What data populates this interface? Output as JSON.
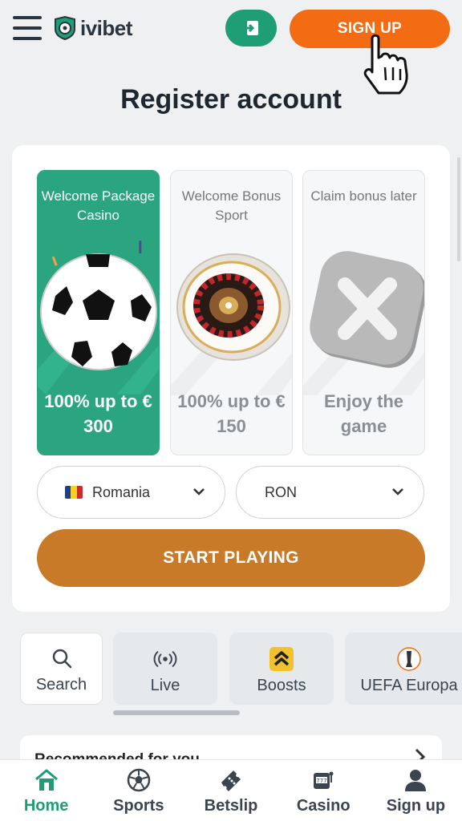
{
  "header": {
    "brand": "ivibet",
    "signup_label": "SIGN UP",
    "colors": {
      "signup": "#f36b12",
      "login": "#1f9d74"
    }
  },
  "title": "Register account",
  "bonuses": [
    {
      "title": "Welcome Package Casino",
      "value": "100% up to € 300",
      "selected": true,
      "icon": "soccer-ball-icon"
    },
    {
      "title": "Welcome Bonus Sport",
      "value": "100% up to € 150",
      "selected": false,
      "icon": "roulette-wheel-icon"
    },
    {
      "title": "Claim bonus later",
      "value": "Enjoy the game",
      "selected": false,
      "icon": "close-x-icon"
    }
  ],
  "country_select": {
    "value": "Romania",
    "flag": "romania-flag-icon"
  },
  "currency_select": {
    "value": "RON"
  },
  "start_label": "START PLAYING",
  "quick_links": [
    {
      "label": "Search",
      "icon": "search-icon"
    },
    {
      "label": "Live",
      "icon": "live-broadcast-icon"
    },
    {
      "label": "Boosts",
      "icon": "boost-chevrons-icon"
    },
    {
      "label": "UEFA Europa",
      "icon": "uefa-europa-trophy-icon"
    }
  ],
  "recommended_title": "Recommended for you",
  "bottom_nav": [
    {
      "label": "Home",
      "icon": "home-icon",
      "active": true
    },
    {
      "label": "Sports",
      "icon": "ball-icon",
      "active": false
    },
    {
      "label": "Betslip",
      "icon": "ticket-icon",
      "active": false
    },
    {
      "label": "Casino",
      "icon": "slot-machine-icon",
      "active": false
    },
    {
      "label": "Sign up",
      "icon": "user-icon",
      "active": false
    }
  ]
}
